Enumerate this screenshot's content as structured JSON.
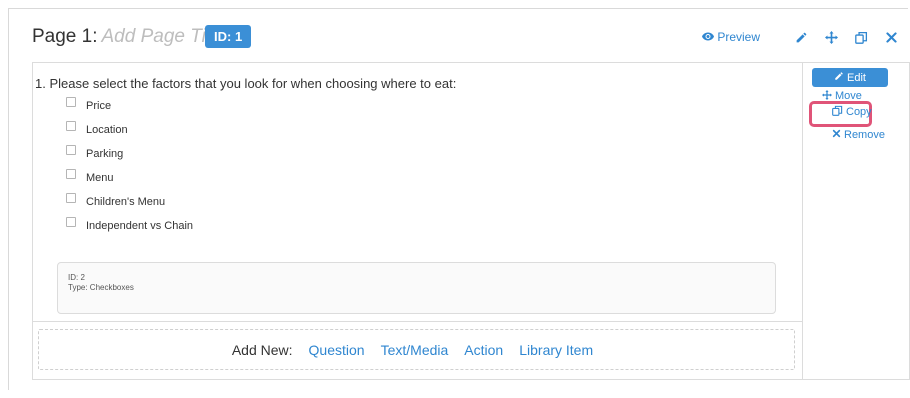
{
  "header": {
    "page_label": "Page 1:",
    "title_placeholder": "Add Page Title",
    "id_badge": "ID: 1",
    "preview_label": "Preview"
  },
  "question": {
    "title": "1. Please select the factors that you look for when choosing where to eat:",
    "options": [
      "Price",
      "Location",
      "Parking",
      "Menu",
      "Children's Menu",
      "Independent vs Chain"
    ],
    "meta_id": "ID: 2",
    "meta_type": "Type: Checkboxes"
  },
  "side_actions": {
    "edit": "Edit",
    "move": "Move",
    "copy": "Copy",
    "remove": "Remove"
  },
  "add_new": {
    "label": "Add New:",
    "links": [
      "Question",
      "Text/Media",
      "Action",
      "Library Item"
    ]
  },
  "colors": {
    "accent": "#3b8fd6",
    "link": "#2f86d0",
    "highlight": "#e05478"
  }
}
